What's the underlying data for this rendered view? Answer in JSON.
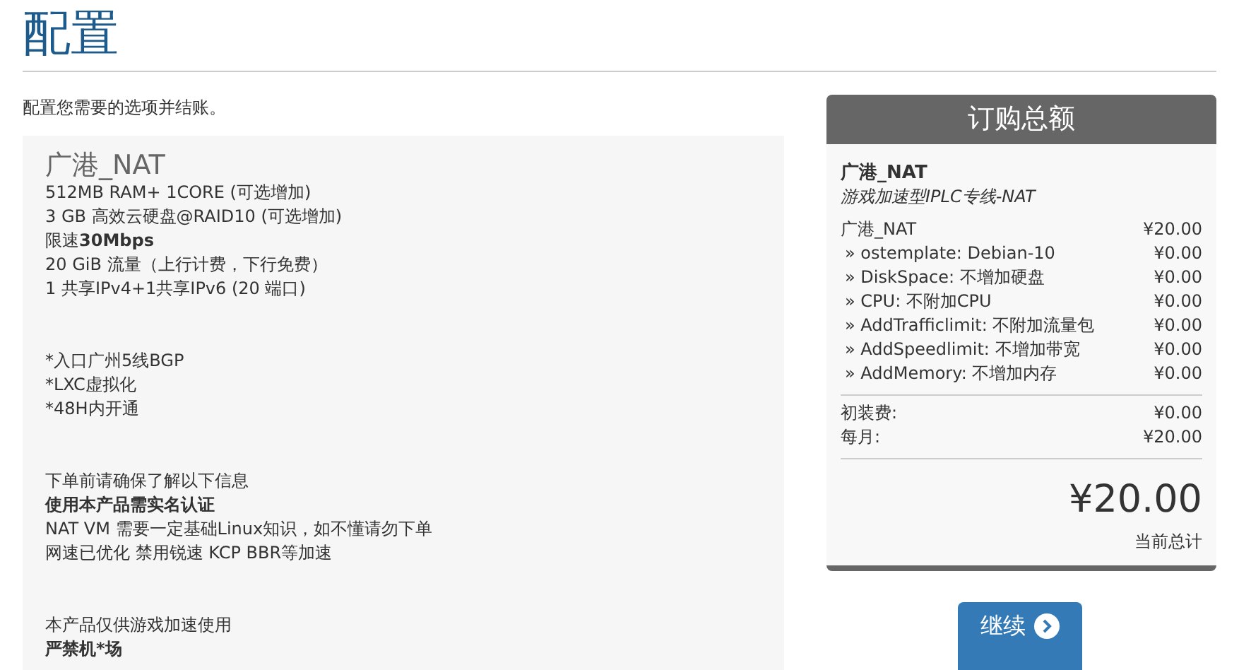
{
  "page_title": "配置",
  "intro": "配置您需要的选项并结账。",
  "product": {
    "name": "广港_NAT",
    "sections": [
      [
        {
          "text": "512MB RAM+ 1CORE (可选增加)",
          "bold": false
        },
        {
          "text": "3 GB 高效云硬盘@RAID10 (可选增加)",
          "bold": false
        },
        {
          "text": "限速**30Mbps**",
          "bold": false
        },
        {
          "text": "20 GiB 流量（上行计费，下行免费）",
          "bold": false
        },
        {
          "text": "1 共享IPv4+1共享IPv6 (20 端口)",
          "bold": false
        }
      ],
      [
        {
          "text": "*入口广州5线BGP",
          "bold": false
        },
        {
          "text": "*LXC虚拟化",
          "bold": false
        },
        {
          "text": "*48H内开通",
          "bold": false
        }
      ],
      [
        {
          "text": "下单前请确保了解以下信息",
          "bold": false
        },
        {
          "text": "使用本产品需实名认证",
          "bold": true
        },
        {
          "text": "NAT VM 需要一定基础Linux知识，如不懂请勿下单",
          "bold": false
        },
        {
          "text": "网速已优化 禁用锐速 KCP BBR等加速",
          "bold": false
        }
      ],
      [
        {
          "text": "本产品仅供游戏加速使用",
          "bold": false
        },
        {
          "text": "严禁机*场",
          "bold": true
        }
      ]
    ]
  },
  "summary": {
    "title": "订购总额",
    "product_name": "广港_NAT",
    "product_desc": "游戏加速型IPLC专线-NAT",
    "items": [
      {
        "kind": "main",
        "label": "广港_NAT",
        "price": "¥20.00"
      },
      {
        "kind": "option",
        "label": "» ostemplate: Debian-10",
        "price": "¥0.00"
      },
      {
        "kind": "option",
        "label": "» DiskSpace: 不增加硬盘",
        "price": "¥0.00"
      },
      {
        "kind": "option",
        "label": "» CPU: 不附加CPU",
        "price": "¥0.00"
      },
      {
        "kind": "option",
        "label": "» AddTrafficlimit: 不附加流量包",
        "price": "¥0.00"
      },
      {
        "kind": "option",
        "label": "» AddSpeedlimit: 不增加带宽",
        "price": "¥0.00"
      },
      {
        "kind": "option",
        "label": "» AddMemory: 不增加内存",
        "price": "¥0.00"
      }
    ],
    "fees": [
      {
        "label": "初装费:",
        "price": "¥0.00"
      },
      {
        "label": "每月:",
        "price": "¥20.00"
      }
    ],
    "total": "¥20.00",
    "total_label": "当前总计"
  },
  "continue_button": {
    "label": "继续"
  }
}
